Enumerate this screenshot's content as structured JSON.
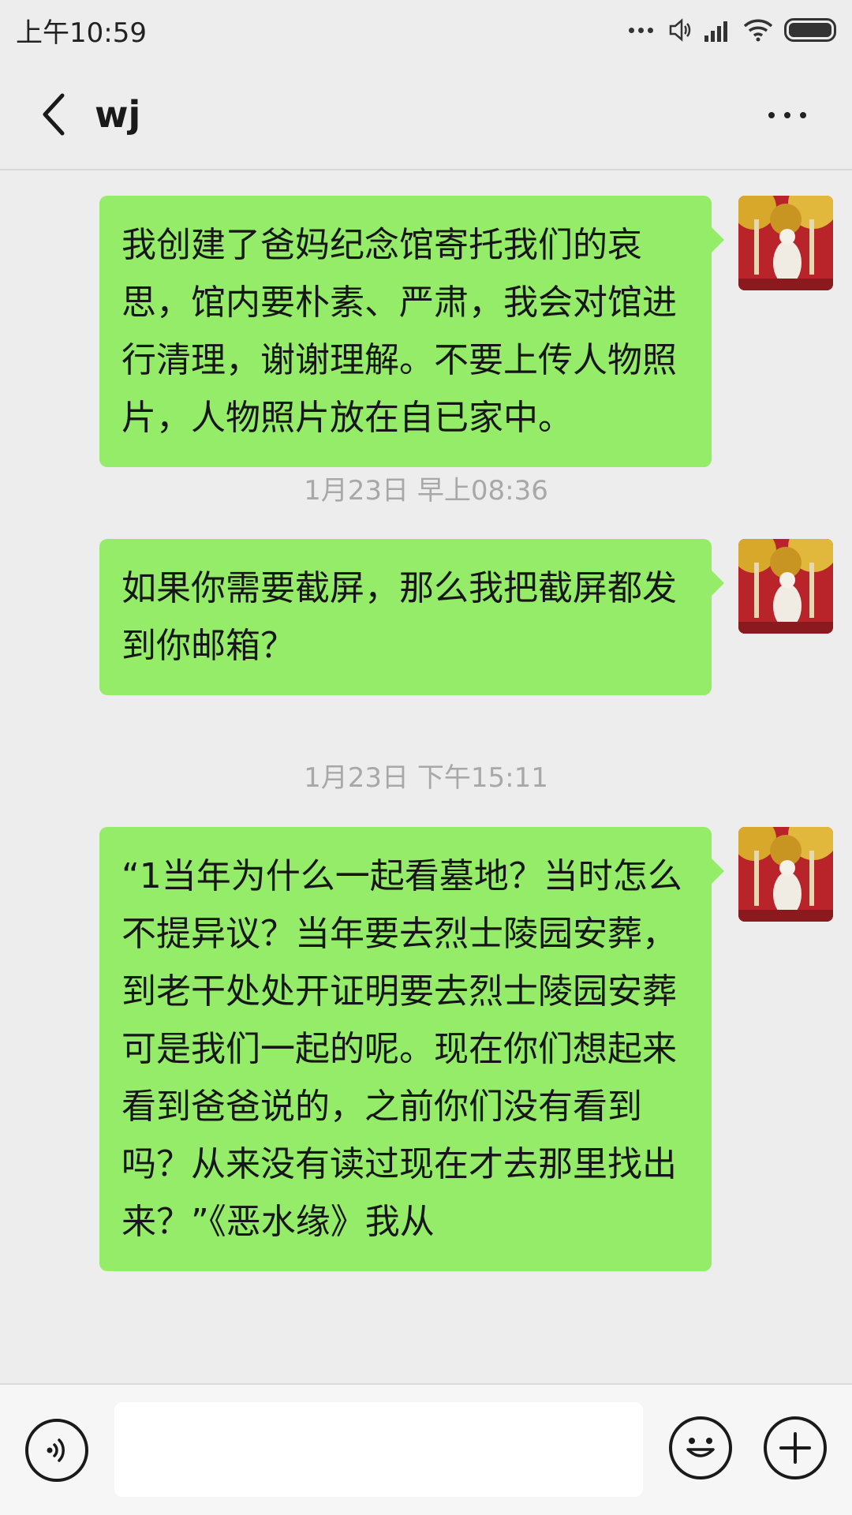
{
  "status_bar": {
    "time": "上午10:59",
    "icons": [
      "more-dots-icon",
      "volume-icon",
      "signal-icon",
      "wifi-icon",
      "battery-icon"
    ]
  },
  "header": {
    "title": "wj",
    "back_icon": "chevron-left-icon",
    "more_icon": "more-horizontal-icon"
  },
  "messages": [
    {
      "type": "sent",
      "text": "我创建了爸妈纪念馆寄托我们的哀思，馆内要朴素、严肃，我会对馆进行清理，谢谢理解。不要上传人物照片，人物照片放在自已家中。"
    },
    {
      "type": "timestamp",
      "text": "1月23日 早上08:36"
    },
    {
      "type": "sent",
      "text": "如果你需要截屏，那么我把截屏都发到你邮箱？"
    },
    {
      "type": "timestamp",
      "text": "1月23日 下午15:11"
    },
    {
      "type": "sent",
      "text": "“1当年为什么一起看墓地？当时怎么不提异议？当年要去烈士陵园安葬，到老干处处开证明要去烈士陵园安葬可是我们一起的呢。现在你们想起来看到爸爸说的，之前你们没有看到吗？从来没有读过现在才去那里找出来？”《恶水缘》我从"
    }
  ],
  "input_bar": {
    "voice_icon": "voice-icon",
    "input_value": "",
    "emoji_icon": "emoji-icon",
    "plus_icon": "plus-icon"
  },
  "colors": {
    "background": "#ededed",
    "bubble_sent": "#95ec69",
    "timestamp_text": "#a8a8a8"
  }
}
